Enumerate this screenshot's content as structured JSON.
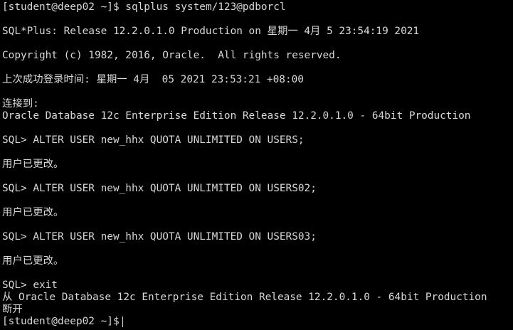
{
  "terminal": {
    "lines": [
      "[student@deep02 ~]$ sqlplus system/123@pdborcl",
      "",
      "SQL*Plus: Release 12.2.0.1.0 Production on 星期一 4月 5 23:54:19 2021",
      "",
      "Copyright (c) 1982, 2016, Oracle.  All rights reserved.",
      "",
      "上次成功登录时间: 星期一 4月  05 2021 23:53:21 +08:00",
      "",
      "连接到:",
      "Oracle Database 12c Enterprise Edition Release 12.2.0.1.0 - 64bit Production",
      "",
      "SQL> ALTER USER new_hhx QUOTA UNLIMITED ON USERS;",
      "",
      "用户已更改。",
      "",
      "SQL> ALTER USER new_hhx QUOTA UNLIMITED ON USERS02;",
      "",
      "用户已更改。",
      "",
      "SQL> ALTER USER new_hhx QUOTA UNLIMITED ON USERS03;",
      "",
      "用户已更改。",
      "",
      "SQL> exit",
      "从 Oracle Database 12c Enterprise Edition Release 12.2.0.1.0 - 64bit Production",
      "断开"
    ],
    "prompt": "[student@deep02 ~]$"
  }
}
